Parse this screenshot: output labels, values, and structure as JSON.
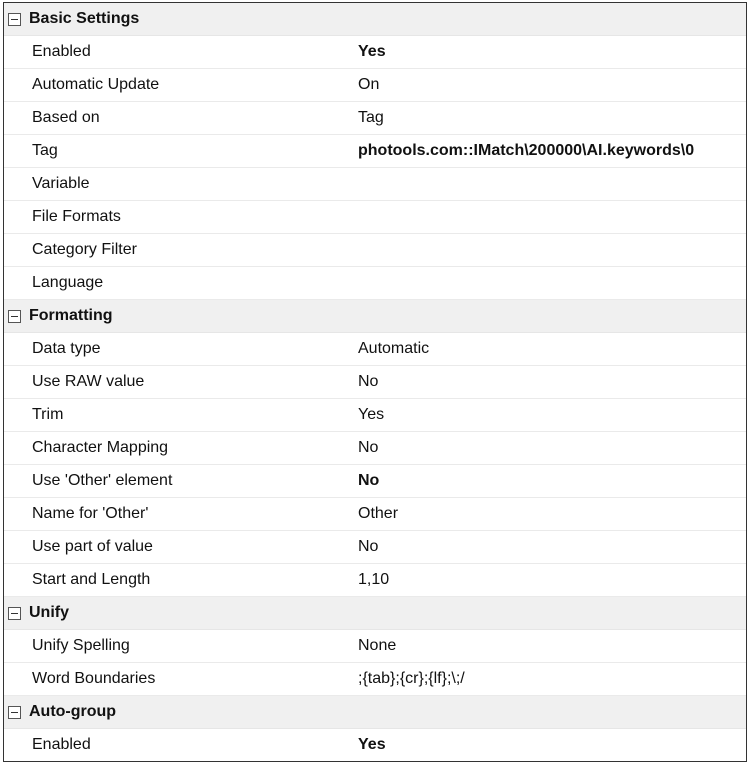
{
  "sections": [
    {
      "title": "Basic Settings",
      "rows": [
        {
          "label": "Enabled",
          "value": "Yes",
          "bold": true
        },
        {
          "label": "Automatic Update",
          "value": "On"
        },
        {
          "label": "Based on",
          "value": "Tag"
        },
        {
          "label": "Tag",
          "value": "photools.com::IMatch\\200000\\AI.keywords\\0",
          "bold": true
        },
        {
          "label": "Variable",
          "value": ""
        },
        {
          "label": "File Formats",
          "value": ""
        },
        {
          "label": "Category Filter",
          "value": ""
        },
        {
          "label": "Language",
          "value": ""
        }
      ]
    },
    {
      "title": "Formatting",
      "rows": [
        {
          "label": "Data type",
          "value": "Automatic"
        },
        {
          "label": "Use RAW value",
          "value": "No"
        },
        {
          "label": "Trim",
          "value": "Yes"
        },
        {
          "label": "Character Mapping",
          "value": "No"
        },
        {
          "label": "Use 'Other' element",
          "value": "No",
          "bold": true
        },
        {
          "label": "Name for 'Other'",
          "value": "Other"
        },
        {
          "label": "Use part of value",
          "value": "No"
        },
        {
          "label": "Start and Length",
          "value": "1,10"
        }
      ]
    },
    {
      "title": "Unify",
      "rows": [
        {
          "label": "Unify Spelling",
          "value": "None"
        },
        {
          "label": "Word Boundaries",
          "value": " ;{tab};{cr};{lf};\\;/"
        }
      ]
    },
    {
      "title": "Auto-group",
      "rows": [
        {
          "label": "Enabled",
          "value": "Yes",
          "bold": true
        }
      ]
    }
  ]
}
